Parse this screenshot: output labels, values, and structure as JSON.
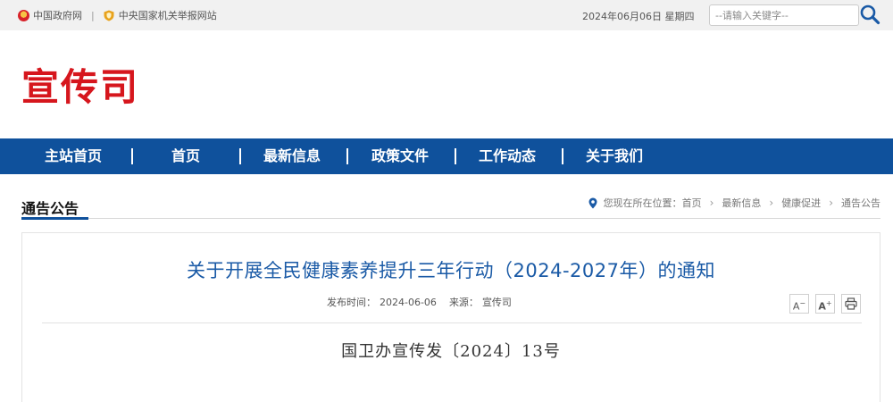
{
  "topbar": {
    "gov_link": "中国政府网",
    "divider": "|",
    "ccdi_link": "中央国家机关举报网站",
    "date": "2024年06月06日 星期四",
    "search_placeholder": "--请输入关键字--"
  },
  "brand": {
    "title": "宣传司",
    "color": "#d6161d"
  },
  "nav": {
    "items": [
      "主站首页",
      "首页",
      "最新信息",
      "政策文件",
      "工作动态",
      "关于我们"
    ],
    "separator": "|",
    "background": "#0f519c"
  },
  "section": {
    "title": "通告公告",
    "location_label": "您现在所在位置：",
    "breadcrumbs": [
      "首页",
      "最新信息",
      "健康促进",
      "通告公告"
    ],
    "arrow": "›"
  },
  "article": {
    "title": "关于开展全民健康素养提升三年行动（2024-2027年）的通知",
    "publish_label": "发布时间：",
    "publish_date": "2024-06-06",
    "source_label": "来源：",
    "source": "宣传司",
    "font_decrease": "A",
    "font_increase": "A",
    "doc_number": "国卫办宣传发〔2024〕13号"
  },
  "icons": {
    "emblem": "national-emblem-icon",
    "shield": "shield-icon",
    "search": "search-icon",
    "location": "location-pin-icon",
    "print": "print-icon"
  }
}
